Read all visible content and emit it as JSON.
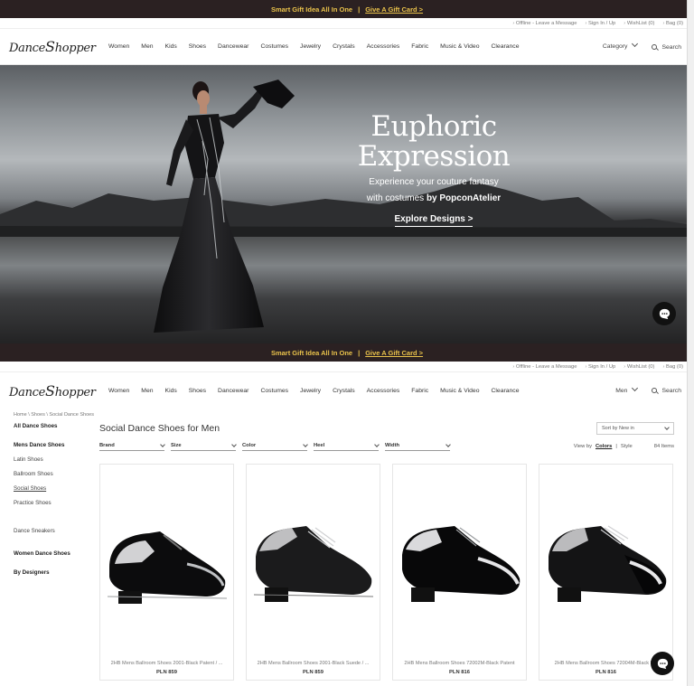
{
  "promo": {
    "text": "Smart Gift Idea All In One",
    "separator": "|",
    "link": "Give A Gift Card >"
  },
  "utility": [
    "Offline - Leave a Message",
    "Sign In / Up",
    "WishList (0)",
    "Bag (0)"
  ],
  "logo": {
    "text_pre": "Dance",
    "text_post": "hopper",
    "s": "S"
  },
  "nav": {
    "items": [
      "Women",
      "Men",
      "Kids",
      "Shoes",
      "Dancewear",
      "Costumes",
      "Jewelry",
      "Crystals",
      "Accessories",
      "Fabric",
      "Music & Video",
      "Clearance"
    ],
    "category_label": "Category",
    "category_label_page2": "Men",
    "search_label": "Search"
  },
  "hero": {
    "title_line1": "Euphoric",
    "title_line2": "Expression",
    "sub_line1": "Experience your couture fantasy",
    "sub_line2_pre": "with costumes",
    "sub_line2_brand": "by PopconAtelier",
    "cta": "Explore Designs >"
  },
  "breadcrumb": "Home \\ Shoes \\ Social Dance Shoes",
  "sidebar": [
    {
      "label": "All Dance Shoes",
      "bold": true
    },
    {
      "label": "Mens Dance Shoes",
      "bold": true
    },
    {
      "label": "Latin Shoes",
      "bold": false
    },
    {
      "label": "Ballroom Shoes",
      "bold": false
    },
    {
      "label": "Social Shoes",
      "bold": false,
      "active": true
    },
    {
      "label": "Practice Shoes",
      "bold": false
    },
    {
      "label": "Dance Sneakers",
      "bold": false
    },
    {
      "label": "Women Dance Shoes",
      "bold": true
    },
    {
      "label": "By Designers",
      "bold": true
    }
  ],
  "listing": {
    "title": "Social Dance Shoes for Men",
    "sort": "Sort by New in",
    "filters": [
      "Brand",
      "Size",
      "Color",
      "Heel",
      "Width"
    ],
    "view_by_label": "View by",
    "view_colors": "Colors",
    "view_sep": "|",
    "view_style": "Style",
    "count": "84 Items"
  },
  "products": [
    {
      "name": "2HB Mens Ballroom Shoes 2001-Black Patent / ...",
      "price": "PLN 859",
      "style": "patent-suede"
    },
    {
      "name": "2HB Mens Ballroom Shoes 2001-Black Suede / ...",
      "price": "PLN 859",
      "style": "suede-patent"
    },
    {
      "name": "2HB Mens Ballroom Shoes 72002M-Black Patent",
      "price": "PLN 816",
      "style": "patent"
    },
    {
      "name": "2HB Mens Ballroom Shoes 72004M-Black P...",
      "price": "PLN 816",
      "style": "suede-toecap"
    }
  ],
  "colors": {
    "promo_bg": "#2b2122",
    "promo_text": "#e9c24b"
  },
  "icons": [
    "chevron-down-icon",
    "search-icon",
    "chat-icon"
  ]
}
